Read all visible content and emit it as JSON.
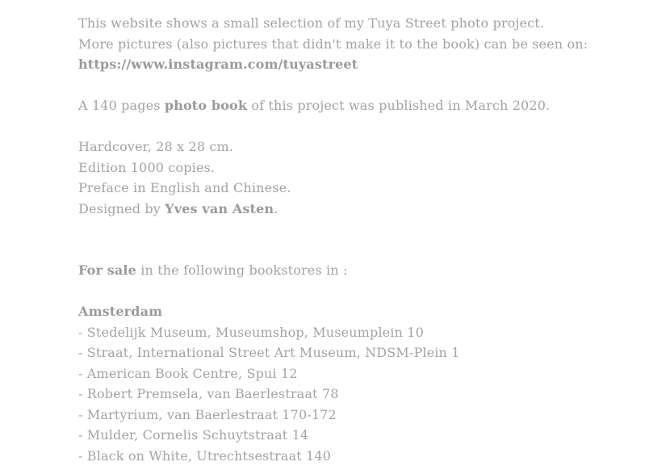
{
  "intro": {
    "line1": "This website shows a small selection of my Tuya Street photo project.",
    "line2": "More pictures (also pictures that didn't make it to the book) can be seen on:",
    "instagram_link": "https://www.instagram.com/tuyastreet"
  },
  "book": {
    "prefix": "A 140 pages ",
    "bold": "photo book",
    "suffix": " of this project was published in March 2020."
  },
  "details": {
    "hardcover": "Hardcover, 28 x 28 cm.",
    "edition": "Edition 1000 copies.",
    "preface": "Preface in English and Chinese.",
    "designed_prefix": "Designed by ",
    "designer": "Yves van Asten",
    "designed_suffix": "."
  },
  "sale": {
    "bold": "For sale",
    "suffix": " in the following bookstores in :"
  },
  "amsterdam": {
    "city": "Amsterdam",
    "stores": [
      "- Stedelijk Museum, Museumshop, Museumplein 10",
      "- Straat, International Street Art Museum, NDSM-Plein 1",
      "- American Book Centre, Spui 12",
      "- Robert Premsela, van Baerlestraat 78",
      "- Martyrium, van Baerlestraat 170-172",
      "- Mulder, Cornelis Schuytstraat 14",
      "- Black on White, Utrechtsestraat 140"
    ]
  },
  "colors": {
    "text": "#a3a3a3",
    "bold_text": "#9a9a9a",
    "background": "#ffffff"
  }
}
